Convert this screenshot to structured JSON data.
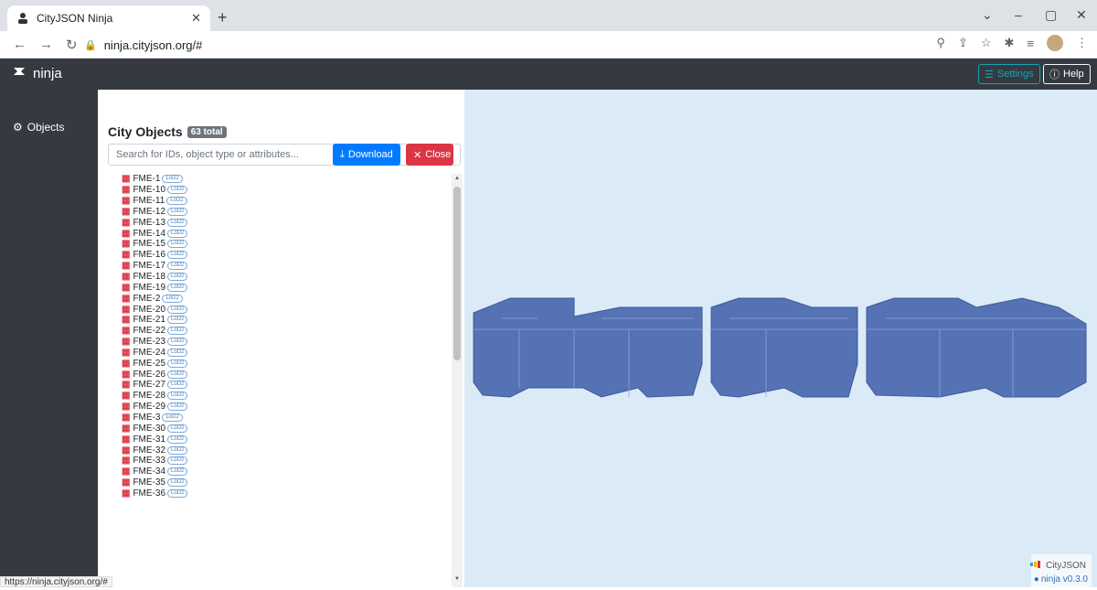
{
  "browser": {
    "tab_title": "CityJSON Ninja",
    "url": "ninja.cityjson.org/#",
    "status_url": "https://ninja.cityjson.org/#"
  },
  "navbar": {
    "brand": "ninja",
    "settings_label": "Settings",
    "help_label": "Help"
  },
  "sidebar": {
    "objects_label": "Objects"
  },
  "panel": {
    "title": "City Objects",
    "total_badge": "63 total",
    "search_placeholder": "Search for IDs, object type or attributes...",
    "download_label": "Download",
    "close_label": "Close",
    "lod_label": "LoD2",
    "items": [
      "FME-1",
      "FME-10",
      "FME-11",
      "FME-12",
      "FME-13",
      "FME-14",
      "FME-15",
      "FME-16",
      "FME-17",
      "FME-18",
      "FME-19",
      "FME-2",
      "FME-20",
      "FME-21",
      "FME-22",
      "FME-23",
      "FME-24",
      "FME-25",
      "FME-26",
      "FME-27",
      "FME-28",
      "FME-29",
      "FME-3",
      "FME-30",
      "FME-31",
      "FME-32",
      "FME-33",
      "FME-34",
      "FME-35",
      "FME-36"
    ]
  },
  "viewer": {
    "cityjson_label": "CityJSON",
    "version_label": "ninja v0.3.0"
  }
}
